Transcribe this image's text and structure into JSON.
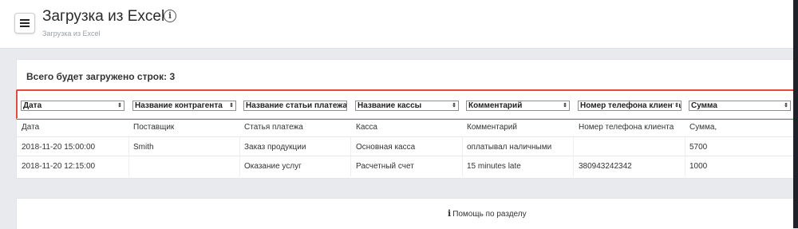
{
  "header": {
    "title": "Загрузка из Excel",
    "breadcrumb": "Загрузка из Excel",
    "info_icon": "info-circle-icon",
    "menu_icon": "hamburger-menu-icon"
  },
  "main": {
    "rows_total_label": "Всего будет загружено строк: 3",
    "column_selects": [
      "Дата",
      "Название контрагента",
      "Название статьи платежа",
      "Название кассы",
      "Комментарий",
      "Номер телефона клиента",
      "Сумма"
    ],
    "rows": [
      [
        "Дата",
        "Поставщик",
        "Статья платежа",
        "Касса",
        "Комментарий",
        "Номер телефона клиента",
        "Сумма,"
      ],
      [
        "2018-11-20 15:00:00",
        "Smith",
        "Заказ продукции",
        "Основная касса",
        "оплатывал наличными",
        "",
        "5700"
      ],
      [
        "2018-11-20 12:15:00",
        "",
        "Оказание услуг",
        "Расчетный счет",
        "15 minutes late",
        "380943242342",
        "1000"
      ]
    ],
    "highlight_color": "#e24a3b"
  },
  "footer": {
    "help_label": "Помощь по разделу",
    "help_icon": "info-icon"
  }
}
